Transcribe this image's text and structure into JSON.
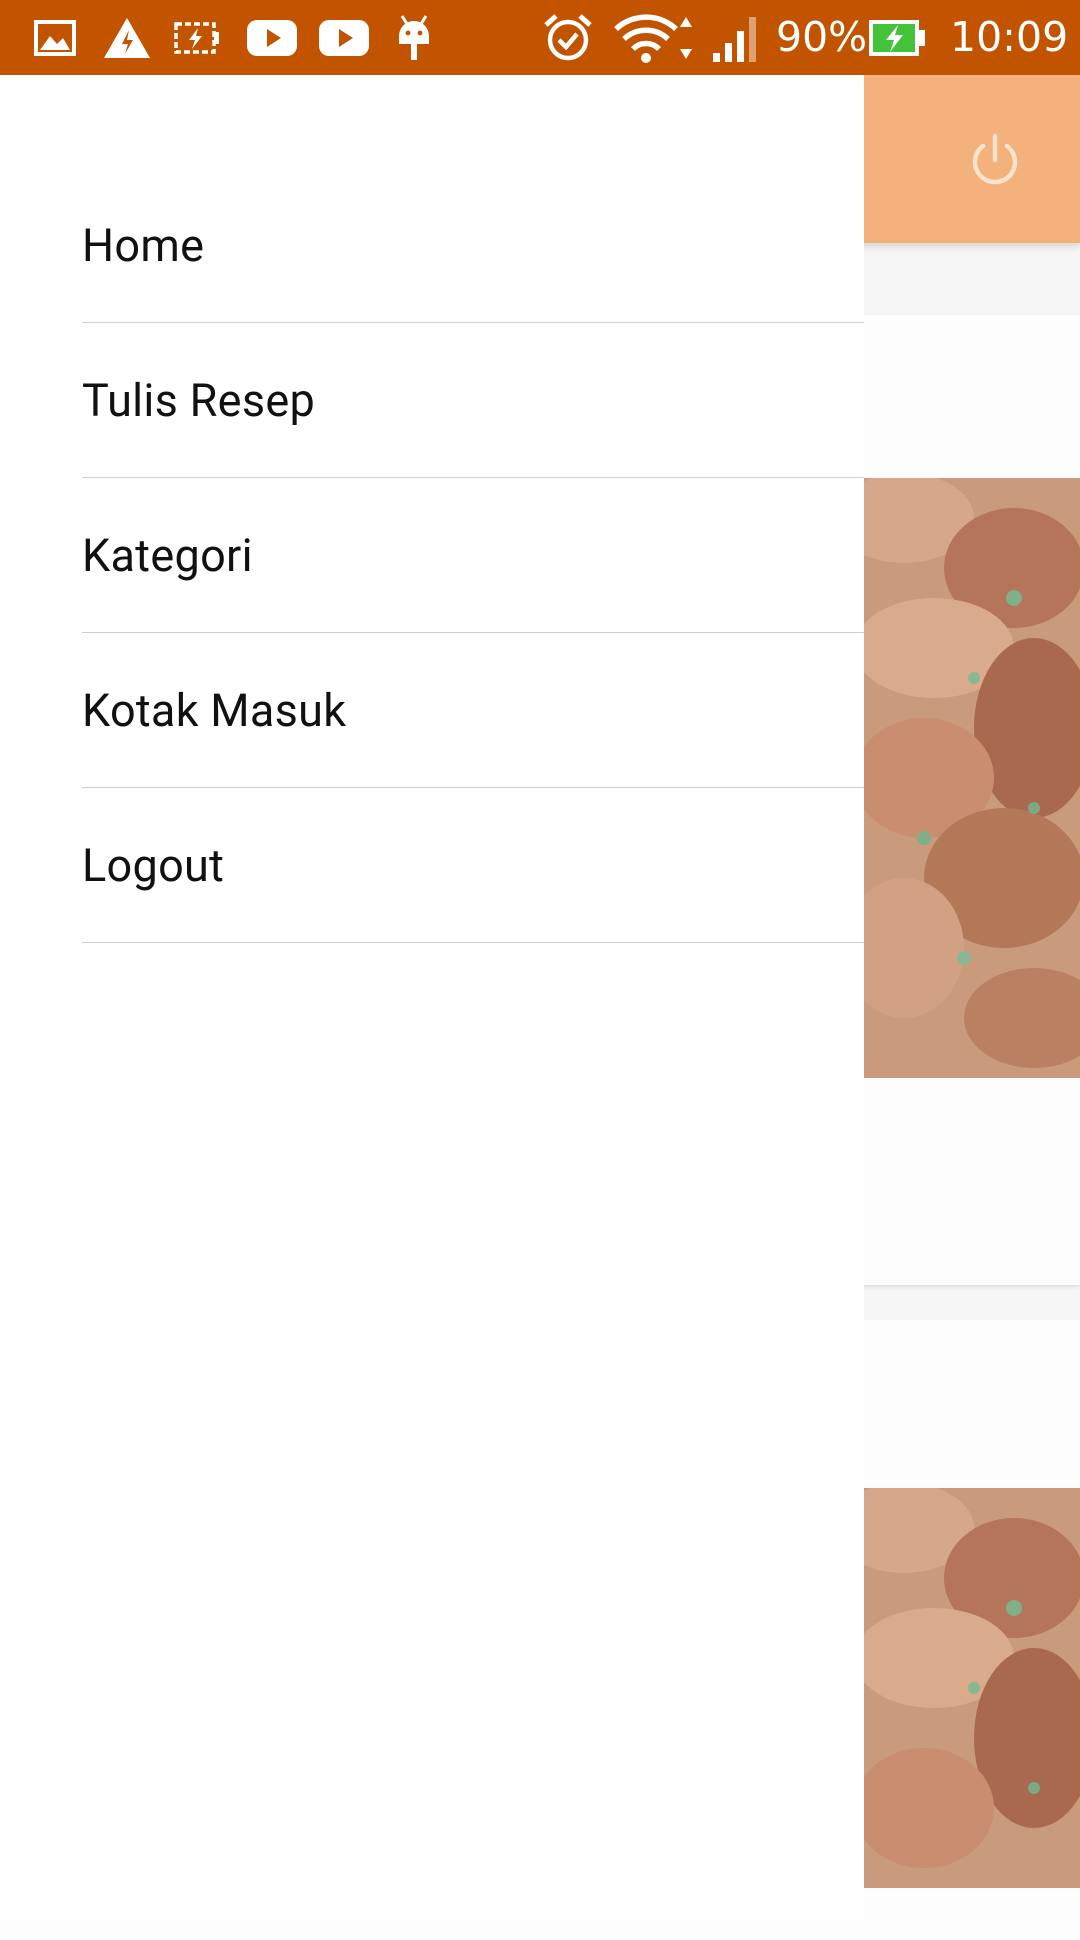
{
  "status_bar": {
    "battery_percent": "90%",
    "time": "10:09",
    "background_color": "#c25400",
    "left_icons": [
      "gallery-icon",
      "warning-icon",
      "battery-saver-icon",
      "youtube-icon",
      "youtube-icon",
      "android-debug-icon"
    ],
    "right_icons": [
      "alarm-icon",
      "wifi-icon",
      "signal-icon",
      "battery-charging-icon"
    ]
  },
  "drawer": {
    "items": [
      {
        "label": "Home"
      },
      {
        "label": "Tulis Resep"
      },
      {
        "label": "Kategori"
      },
      {
        "label": "Kotak Masuk"
      },
      {
        "label": "Logout"
      }
    ]
  },
  "background_app": {
    "toolbar_color": "#f3b17c",
    "toolbar_icons": [
      "power-icon"
    ]
  }
}
